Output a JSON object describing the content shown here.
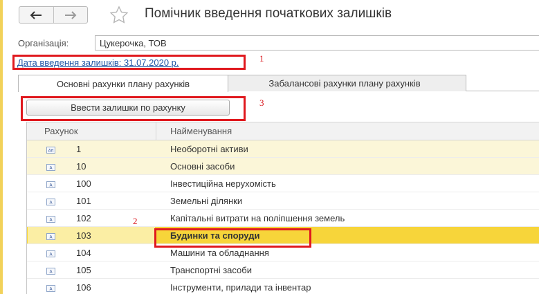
{
  "window": {
    "title": "Помічник введення початкових залишків"
  },
  "organization": {
    "label": "Організація:",
    "value": "Цукерочка, ТОВ"
  },
  "date_link": "Дата введення залишків: 31.07.2020 р.",
  "annotations": [
    "1",
    "2",
    "3"
  ],
  "tabs": [
    {
      "label": "Основні рахунки плану рахунків",
      "active": true
    },
    {
      "label": "Забалансові рахунки плану рахунків",
      "active": false
    }
  ],
  "action_button": "Ввести залишки по рахунку",
  "table": {
    "columns": [
      "Рахунок",
      "Найменування"
    ],
    "rows": [
      {
        "code": "1",
        "name": "Необоротні активи",
        "icon": "account-group-icon"
      },
      {
        "code": "10",
        "name": "Основні засоби",
        "icon": "account-icon"
      },
      {
        "code": "100",
        "name": "Інвестиційна нерухомість",
        "icon": "account-icon"
      },
      {
        "code": "101",
        "name": "Земельні ділянки",
        "icon": "account-icon"
      },
      {
        "code": "102",
        "name": "Капітальні витрати на поліпшення  земель",
        "icon": "account-icon"
      },
      {
        "code": "103",
        "name": "Будинки та споруди",
        "icon": "account-icon"
      },
      {
        "code": "104",
        "name": "Машини та обладнання",
        "icon": "account-icon"
      },
      {
        "code": "105",
        "name": "Транспортні засоби",
        "icon": "account-icon"
      },
      {
        "code": "106",
        "name": "Інструменти, прилади та інвентар",
        "icon": "account-icon"
      }
    ]
  },
  "colors": {
    "highlight_row": "#fbf6d8",
    "selected_row": "#f7d53a",
    "annotation_red": "#e0191e",
    "link_blue": "#2157a6"
  }
}
